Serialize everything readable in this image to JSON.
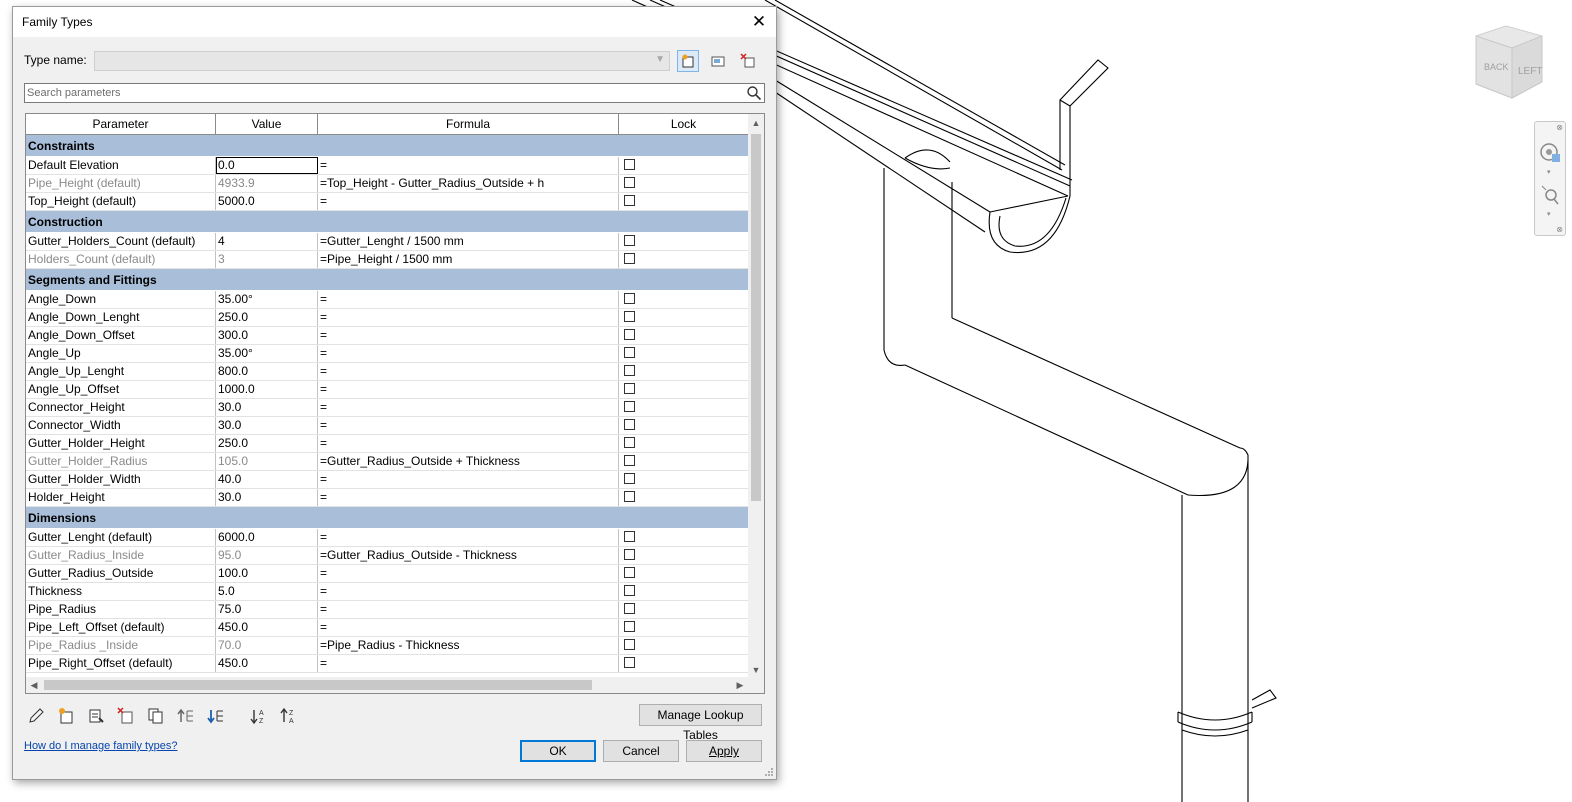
{
  "dialog": {
    "title": "Family Types",
    "type_name_label": "Type name:",
    "type_name_value": "",
    "search_placeholder": "Search parameters"
  },
  "table": {
    "headers": [
      "Parameter",
      "Value",
      "Formula",
      "Lock"
    ],
    "groups": [
      {
        "name": "Constraints",
        "rows": [
          {
            "param": "Default Elevation",
            "value": "0.0",
            "formula": "=",
            "disabled": false,
            "editing": true
          },
          {
            "param": "Pipe_Height (default)",
            "value": "4933.9",
            "formula": "=Top_Height - Gutter_Radius_Outside + h",
            "disabled": true
          },
          {
            "param": "Top_Height (default)",
            "value": "5000.0",
            "formula": "=",
            "disabled": false
          }
        ]
      },
      {
        "name": "Construction",
        "rows": [
          {
            "param": "Gutter_Holders_Count (default)",
            "value": "4",
            "formula": "=Gutter_Lenght / 1500 mm",
            "disabled": false
          },
          {
            "param": "Holders_Count (default)",
            "value": "3",
            "formula": "=Pipe_Height / 1500 mm",
            "disabled": true
          }
        ]
      },
      {
        "name": "Segments and Fittings",
        "rows": [
          {
            "param": "Angle_Down",
            "value": "35.00°",
            "formula": "=",
            "disabled": false
          },
          {
            "param": "Angle_Down_Lenght",
            "value": "250.0",
            "formula": "=",
            "disabled": false
          },
          {
            "param": "Angle_Down_Offset",
            "value": "300.0",
            "formula": "=",
            "disabled": false
          },
          {
            "param": "Angle_Up",
            "value": "35.00°",
            "formula": "=",
            "disabled": false
          },
          {
            "param": "Angle_Up_Lenght",
            "value": "800.0",
            "formula": "=",
            "disabled": false
          },
          {
            "param": "Angle_Up_Offset",
            "value": "1000.0",
            "formula": "=",
            "disabled": false
          },
          {
            "param": "Connector_Height",
            "value": "30.0",
            "formula": "=",
            "disabled": false
          },
          {
            "param": "Connector_Width",
            "value": "30.0",
            "formula": "=",
            "disabled": false
          },
          {
            "param": "Gutter_Holder_Height",
            "value": "250.0",
            "formula": "=",
            "disabled": false
          },
          {
            "param": "Gutter_Holder_Radius",
            "value": "105.0",
            "formula": "=Gutter_Radius_Outside + Thickness",
            "disabled": true
          },
          {
            "param": "Gutter_Holder_Width",
            "value": "40.0",
            "formula": "=",
            "disabled": false
          },
          {
            "param": "Holder_Height",
            "value": "30.0",
            "formula": "=",
            "disabled": false
          }
        ]
      },
      {
        "name": "Dimensions",
        "rows": [
          {
            "param": "Gutter_Lenght (default)",
            "value": "6000.0",
            "formula": "=",
            "disabled": false
          },
          {
            "param": "Gutter_Radius_Inside",
            "value": "95.0",
            "formula": "=Gutter_Radius_Outside - Thickness",
            "disabled": true
          },
          {
            "param": "Gutter_Radius_Outside",
            "value": "100.0",
            "formula": "=",
            "disabled": false
          },
          {
            "param": "Thickness",
            "value": "5.0",
            "formula": "=",
            "disabled": false
          },
          {
            "param": "Pipe_Radius",
            "value": "75.0",
            "formula": "=",
            "disabled": false
          },
          {
            "param": "Pipe_Left_Offset (default)",
            "value": "450.0",
            "formula": "=",
            "disabled": false
          },
          {
            "param": "Pipe_Radius _Inside",
            "value": "70.0",
            "formula": "=Pipe_Radius - Thickness",
            "disabled": true
          },
          {
            "param": "Pipe_Right_Offset (default)",
            "value": "450.0",
            "formula": "=",
            "disabled": false
          }
        ]
      }
    ]
  },
  "toolbar_icons": [
    "pencil-icon",
    "new-parameter-icon",
    "parameter-properties-icon",
    "delete-parameter-icon",
    "copy-parameter-icon",
    "move-up-icon",
    "move-down-icon",
    "sort-ascending-icon",
    "sort-descending-icon"
  ],
  "buttons": {
    "manage_lookup": "Manage Lookup Tables",
    "ok": "OK",
    "cancel": "Cancel",
    "apply": "Apply"
  },
  "help_link": "How do I manage family types?",
  "viewcube": {
    "back": "BACK",
    "left": "LEFT"
  }
}
